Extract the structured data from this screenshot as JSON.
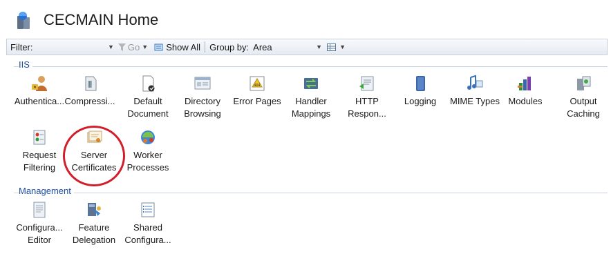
{
  "header": {
    "title": "CECMAIN Home",
    "icon": "iis-server-icon"
  },
  "toolbar": {
    "filter_label": "Filter:",
    "filter_value": "",
    "go_label": "Go",
    "show_all_label": "Show All",
    "group_by_label": "Group by:",
    "group_by_value": "Area"
  },
  "sections": {
    "iis": {
      "label": "IIS",
      "items": [
        {
          "label": "Authentica...",
          "icon": "authentication-icon"
        },
        {
          "label": "Compressi...",
          "icon": "compression-icon"
        },
        {
          "label": "Default\nDocument",
          "icon": "default-document-icon"
        },
        {
          "label": "Directory\nBrowsing",
          "icon": "directory-browsing-icon"
        },
        {
          "label": "Error Pages",
          "icon": "error-pages-icon",
          "badge": "404"
        },
        {
          "label": "Handler\nMappings",
          "icon": "handler-mappings-icon"
        },
        {
          "label": "HTTP\nRespon...",
          "icon": "http-response-headers-icon"
        },
        {
          "label": "Logging",
          "icon": "logging-icon"
        },
        {
          "label": "MIME Types",
          "icon": "mime-types-icon"
        },
        {
          "label": "Modules",
          "icon": "modules-icon"
        },
        {
          "label": "Output\nCaching",
          "icon": "output-caching-icon"
        },
        {
          "label": "Request\nFiltering",
          "icon": "request-filtering-icon"
        },
        {
          "label": "Server\nCertificates",
          "icon": "server-certificates-icon"
        },
        {
          "label": "Worker\nProcesses",
          "icon": "worker-processes-icon"
        }
      ]
    },
    "management": {
      "label": "Management",
      "items": [
        {
          "label": "Configura...\nEditor",
          "icon": "configuration-editor-icon"
        },
        {
          "label": "Feature\nDelegation",
          "icon": "feature-delegation-icon"
        },
        {
          "label": "Shared\nConfigura...",
          "icon": "shared-configuration-icon"
        }
      ]
    }
  },
  "colors": {
    "highlight": "#d21e2b",
    "section_label": "#1f4fa0"
  }
}
